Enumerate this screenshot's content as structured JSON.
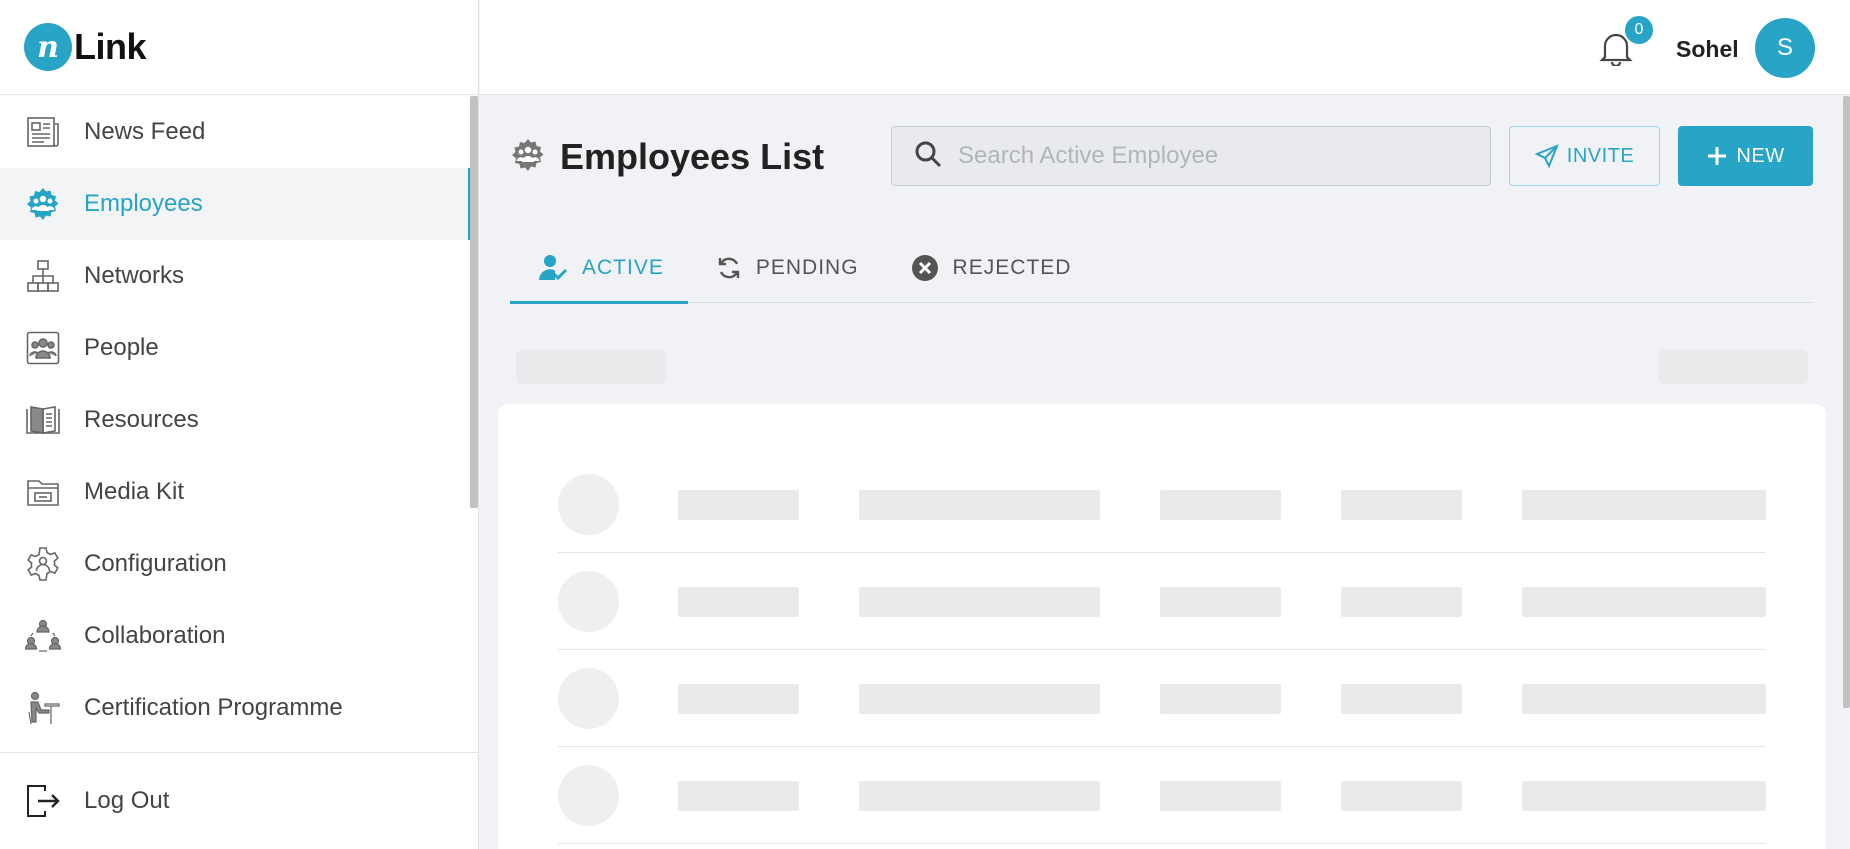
{
  "app": {
    "logo_mark": "n",
    "logo_text": "Link"
  },
  "sidebar": {
    "items": [
      {
        "label": "News Feed",
        "icon": "newspaper-icon",
        "active": false
      },
      {
        "label": "Employees",
        "icon": "employees-gear-icon",
        "active": true
      },
      {
        "label": "Networks",
        "icon": "network-icon",
        "active": false
      },
      {
        "label": "People",
        "icon": "people-icon",
        "active": false
      },
      {
        "label": "Resources",
        "icon": "book-icon",
        "active": false
      },
      {
        "label": "Media Kit",
        "icon": "folder-icon",
        "active": false
      },
      {
        "label": "Configuration",
        "icon": "gear-icon",
        "active": false
      },
      {
        "label": "Collaboration",
        "icon": "collaboration-icon",
        "active": false
      },
      {
        "label": "Certification Programme",
        "icon": "certification-icon",
        "active": false
      }
    ],
    "logout_label": "Log Out"
  },
  "header": {
    "notification_count": "0",
    "username": "Sohel",
    "avatar_initial": "S"
  },
  "main": {
    "title": "Employees List",
    "search_placeholder": "Search Active Employee",
    "invite_label": "INVITE",
    "new_label": "NEW",
    "tabs": [
      {
        "label": "ACTIVE",
        "icon": "user-check-icon",
        "active": true
      },
      {
        "label": "PENDING",
        "icon": "refresh-icon",
        "active": false
      },
      {
        "label": "REJECTED",
        "icon": "x-circle-icon",
        "active": false
      }
    ]
  },
  "colors": {
    "accent": "#27a4c6",
    "background": "#f0f2f5",
    "skeleton": "#e9eaec"
  }
}
